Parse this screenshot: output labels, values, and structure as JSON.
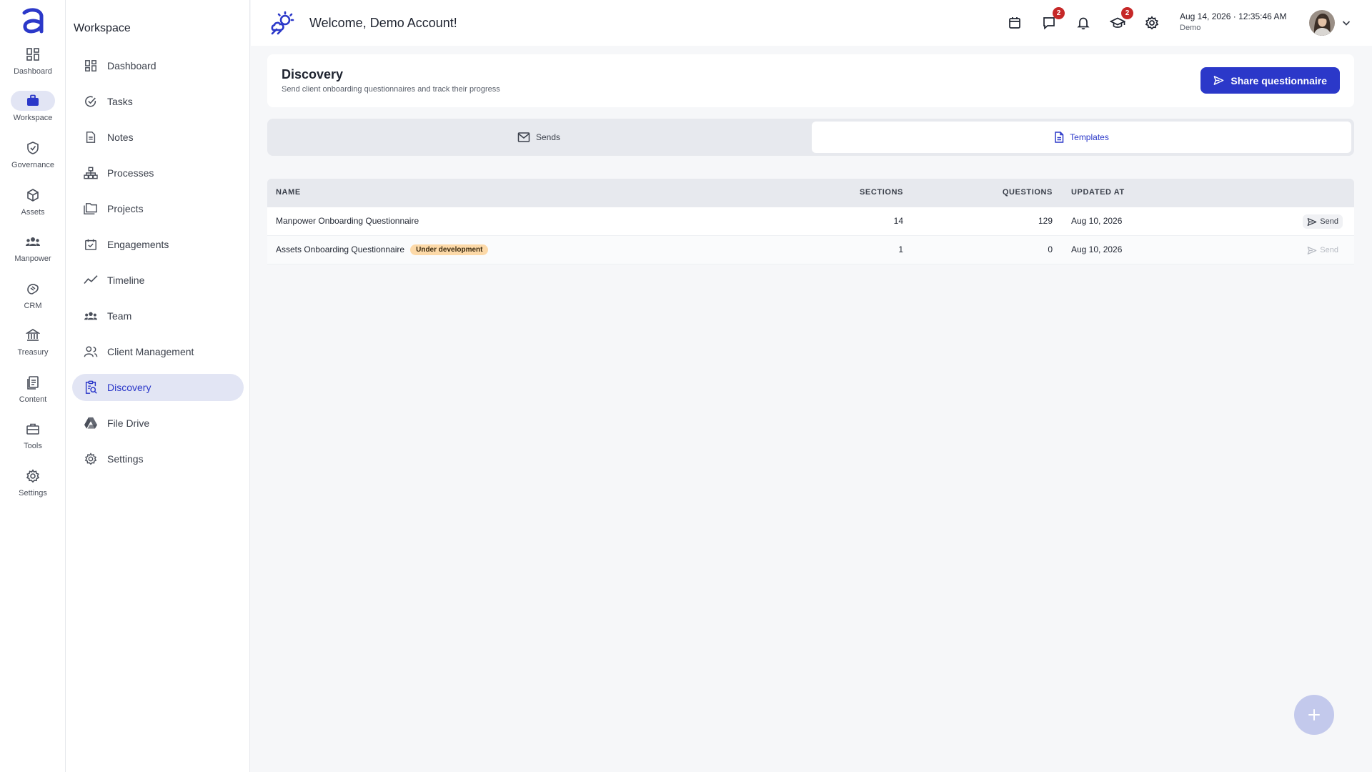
{
  "rail": {
    "items": [
      {
        "label": "Dashboard",
        "icon": "dashboard-icon"
      },
      {
        "label": "Workspace",
        "icon": "briefcase-icon"
      },
      {
        "label": "Governance",
        "icon": "shield-icon"
      },
      {
        "label": "Assets",
        "icon": "cube-icon"
      },
      {
        "label": "Manpower",
        "icon": "people-icon"
      },
      {
        "label": "CRM",
        "icon": "handshake-icon"
      },
      {
        "label": "Treasury",
        "icon": "bank-icon"
      },
      {
        "label": "Content",
        "icon": "documents-icon"
      },
      {
        "label": "Tools",
        "icon": "toolbox-icon"
      },
      {
        "label": "Settings",
        "icon": "gear-icon"
      }
    ],
    "active": "Workspace"
  },
  "sidebar": {
    "title": "Workspace",
    "items": [
      {
        "label": "Dashboard",
        "icon": "dashboard-icon"
      },
      {
        "label": "Tasks",
        "icon": "check-circle-icon"
      },
      {
        "label": "Notes",
        "icon": "note-icon"
      },
      {
        "label": "Processes",
        "icon": "hierarchy-icon"
      },
      {
        "label": "Projects",
        "icon": "folders-icon"
      },
      {
        "label": "Engagements",
        "icon": "calendar-check-icon"
      },
      {
        "label": "Timeline",
        "icon": "trend-line-icon"
      },
      {
        "label": "Team",
        "icon": "team-icon"
      },
      {
        "label": "Client Management",
        "icon": "client-icon"
      },
      {
        "label": "Discovery",
        "icon": "clipboard-search-icon"
      },
      {
        "label": "File Drive",
        "icon": "drive-icon"
      },
      {
        "label": "Settings",
        "icon": "gear-icon"
      }
    ],
    "active": "Discovery"
  },
  "header": {
    "welcome": "Welcome, Demo Account!",
    "date": "Aug 14, 2026",
    "separator": "·",
    "time": "12:35:46 AM",
    "user_label": "Demo",
    "icons": [
      {
        "icon": "calendar-icon",
        "badge": ""
      },
      {
        "icon": "chat-icon",
        "badge": "2"
      },
      {
        "icon": "bell-icon",
        "badge": ""
      },
      {
        "icon": "graduation-cap-icon",
        "badge": "2"
      },
      {
        "icon": "gear-icon",
        "badge": ""
      }
    ]
  },
  "page": {
    "title": "Discovery",
    "subtitle": "Send client onboarding questionnaires and track their progress",
    "share_label": "Share questionnaire"
  },
  "tabs": [
    {
      "label": "Sends",
      "icon": "mail-icon",
      "active": false
    },
    {
      "label": "Templates",
      "icon": "document-icon",
      "active": true
    }
  ],
  "table": {
    "columns": {
      "name": "NAME",
      "sections": "SECTIONS",
      "questions": "QUESTIONS",
      "updated": "UPDATED AT"
    },
    "rows": [
      {
        "name": "Manpower Onboarding Questionnaire",
        "tag": "",
        "sections": "14",
        "questions": "129",
        "updated": "Aug 10, 2026",
        "action": "Send",
        "action_enabled": true
      },
      {
        "name": "Assets Onboarding Questionnaire",
        "tag": "Under development",
        "sections": "1",
        "questions": "0",
        "updated": "Aug 10, 2026",
        "action": "Send",
        "action_enabled": false
      }
    ]
  },
  "colors": {
    "accent": "#2b38c9",
    "active_bg": "#e2e5f4",
    "badge": "#c62828",
    "tag_bg": "#fcd9a8",
    "fab": "#c3c9ec"
  }
}
